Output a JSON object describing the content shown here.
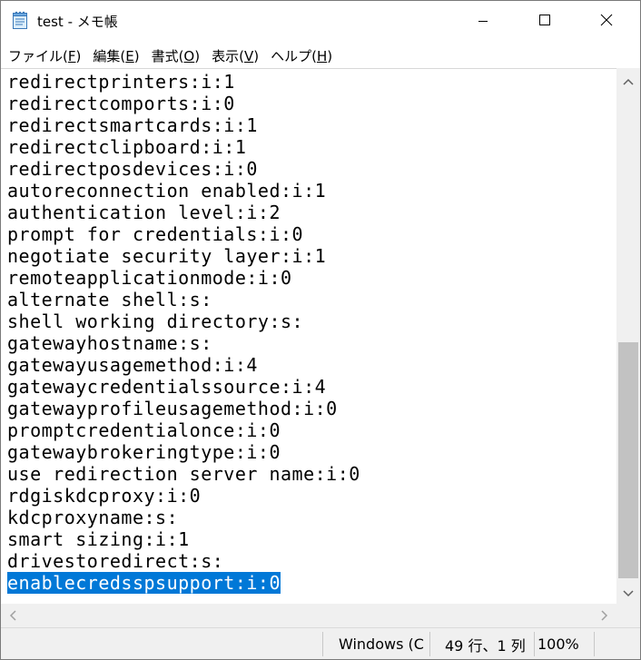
{
  "window": {
    "title": "test - メモ帳"
  },
  "menu": [
    {
      "label": "ファイル(",
      "accel": "F",
      "end": ")"
    },
    {
      "label": "編集(",
      "accel": "E",
      "end": ")"
    },
    {
      "label": "書式(",
      "accel": "O",
      "end": ")"
    },
    {
      "label": "表示(",
      "accel": "V",
      "end": ")"
    },
    {
      "label": "ヘルプ(",
      "accel": "H",
      "end": ")"
    }
  ],
  "editor": {
    "lines": [
      "redirectprinters:i:1",
      "redirectcomports:i:0",
      "redirectsmartcards:i:1",
      "redirectclipboard:i:1",
      "redirectposdevices:i:0",
      "autoreconnection enabled:i:1",
      "authentication level:i:2",
      "prompt for credentials:i:0",
      "negotiate security layer:i:1",
      "remoteapplicationmode:i:0",
      "alternate shell:s:",
      "shell working directory:s:",
      "gatewayhostname:s:",
      "gatewayusagemethod:i:4",
      "gatewaycredentialssource:i:4",
      "gatewayprofileusagemethod:i:0",
      "promptcredentialonce:i:0",
      "gatewaybrokeringtype:i:0",
      "use redirection server name:i:0",
      "rdgiskdcproxy:i:0",
      "kdcproxyname:s:",
      "smart sizing:i:1",
      "drivestoredirect:s:",
      "enablecredsspsupport:i:0"
    ],
    "selected_line_index": 23
  },
  "status": {
    "encoding": "Windows (C",
    "position": "49 行、1 列",
    "zoom": "100%"
  },
  "colors": {
    "selection": "#0078d7",
    "scroll_thumb": "#c2c2c2",
    "chrome": "#f0f0f0"
  },
  "icons": {
    "app": "notepad-icon",
    "minimize": "minimize-icon",
    "maximize": "maximize-icon",
    "close": "close-icon"
  }
}
